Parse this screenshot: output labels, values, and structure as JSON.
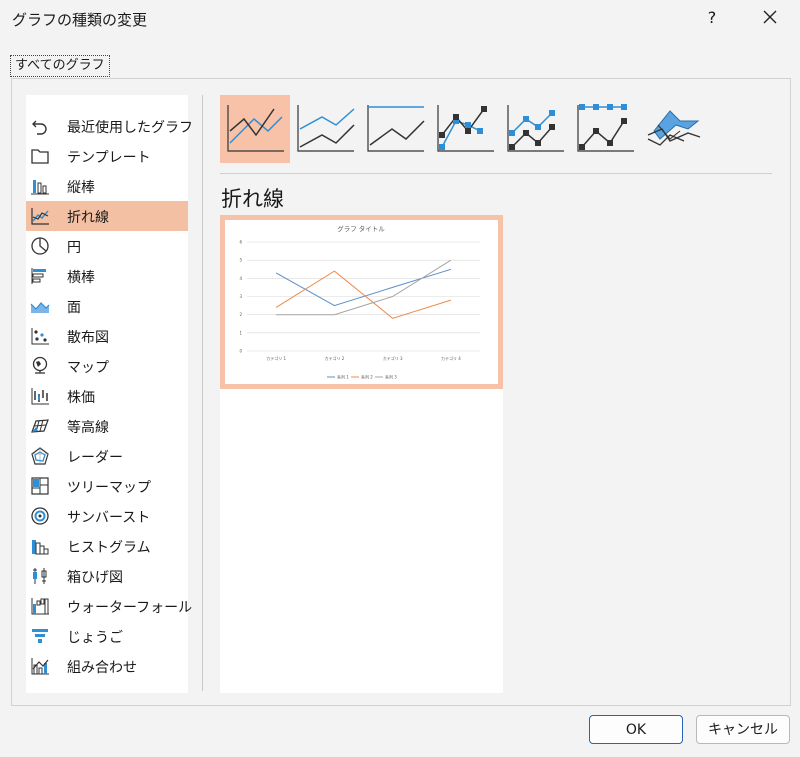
{
  "dialog": {
    "title": "グラフの種類の変更",
    "help": "?"
  },
  "tab": {
    "label": "すべてのグラフ"
  },
  "sidebar": {
    "items": [
      {
        "label": "最近使用したグラフ",
        "icon": "recent-icon"
      },
      {
        "label": "テンプレート",
        "icon": "folder-icon"
      },
      {
        "label": "縦棒",
        "icon": "column-chart-icon"
      },
      {
        "label": "折れ線",
        "icon": "line-chart-icon",
        "selected": true
      },
      {
        "label": "円",
        "icon": "pie-chart-icon"
      },
      {
        "label": "横棒",
        "icon": "bar-chart-icon"
      },
      {
        "label": "面",
        "icon": "area-chart-icon"
      },
      {
        "label": "散布図",
        "icon": "scatter-chart-icon"
      },
      {
        "label": "マップ",
        "icon": "map-globe-icon"
      },
      {
        "label": "株価",
        "icon": "stock-chart-icon"
      },
      {
        "label": "等高線",
        "icon": "surface-chart-icon"
      },
      {
        "label": "レーダー",
        "icon": "radar-chart-icon"
      },
      {
        "label": "ツリーマップ",
        "icon": "treemap-icon"
      },
      {
        "label": "サンバースト",
        "icon": "sunburst-icon"
      },
      {
        "label": "ヒストグラム",
        "icon": "histogram-icon"
      },
      {
        "label": "箱ひげ図",
        "icon": "box-whisker-icon"
      },
      {
        "label": "ウォーターフォール",
        "icon": "waterfall-icon"
      },
      {
        "label": "じょうご",
        "icon": "funnel-icon"
      },
      {
        "label": "組み合わせ",
        "icon": "combo-chart-icon"
      }
    ]
  },
  "subtypes": {
    "heading": "折れ線",
    "selected_index": 0,
    "count": 7
  },
  "preview": {
    "chart_data": {
      "type": "line",
      "title": "グラフ タイトル",
      "categories": [
        "カテゴリ 1",
        "カテゴリ 2",
        "カテゴリ 3",
        "カテゴリ 4"
      ],
      "ylim": [
        0,
        6
      ],
      "yticks": [
        "0",
        "1",
        "2",
        "3",
        "4",
        "5",
        "6"
      ],
      "grid": true,
      "legend": "bottom",
      "series": [
        {
          "name": "系列 1",
          "values": [
            4.3,
            2.5,
            3.5,
            4.5
          ],
          "color": "#5b8ec9"
        },
        {
          "name": "系列 2",
          "values": [
            2.4,
            4.4,
            1.8,
            2.8
          ],
          "color": "#ed8b4c"
        },
        {
          "name": "系列 3",
          "values": [
            2.0,
            2.0,
            3.0,
            5.0
          ],
          "color": "#a5a5a5"
        }
      ]
    }
  },
  "buttons": {
    "ok": "OK",
    "cancel": "キャンセル"
  },
  "colors": {
    "selection": "#f3c0a4",
    "accent_blue": "#2f8fd6",
    "ok_border": "#2a62b8"
  }
}
